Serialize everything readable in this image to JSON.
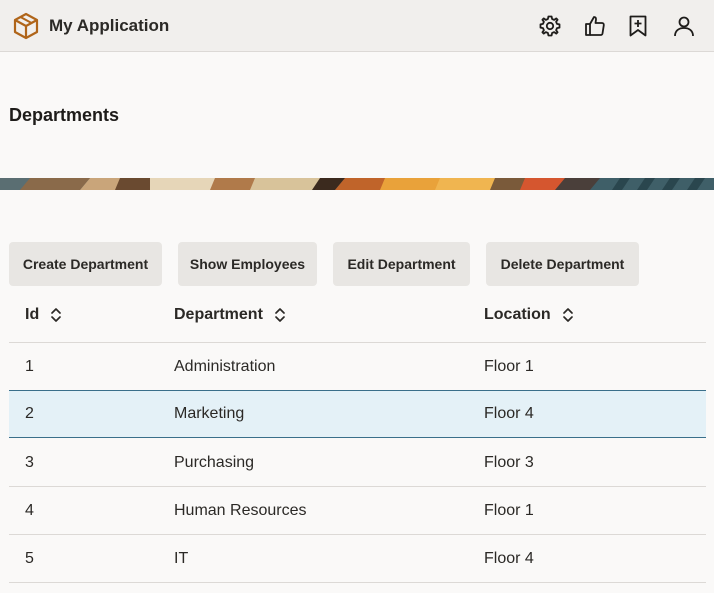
{
  "app": {
    "title": "My Application",
    "logo_icon": "box-icon",
    "header_icons": [
      "gear-icon",
      "thumbs-up-icon",
      "bookmark-add-icon",
      "user-icon"
    ]
  },
  "page": {
    "title": "Departments"
  },
  "toolbar": {
    "create_label": "Create Department",
    "show_label": "Show Employees",
    "edit_label": "Edit Department",
    "delete_label": "Delete Department"
  },
  "table": {
    "columns": [
      "Id",
      "Department",
      "Location"
    ],
    "rows": [
      {
        "id": "1",
        "department": "Administration",
        "location": "Floor 1"
      },
      {
        "id": "2",
        "department": "Marketing",
        "location": "Floor 4"
      },
      {
        "id": "3",
        "department": "Purchasing",
        "location": "Floor 3"
      },
      {
        "id": "4",
        "department": "Human Resources",
        "location": "Floor 1"
      },
      {
        "id": "5",
        "department": "IT",
        "location": "Floor 4"
      }
    ],
    "selected_row": "2"
  },
  "colors": {
    "accent": "#c6741d",
    "selected_row_bg": "#e4f1f7",
    "selected_row_border": "#3a6f8a",
    "button_bg": "#e8e6e3"
  }
}
